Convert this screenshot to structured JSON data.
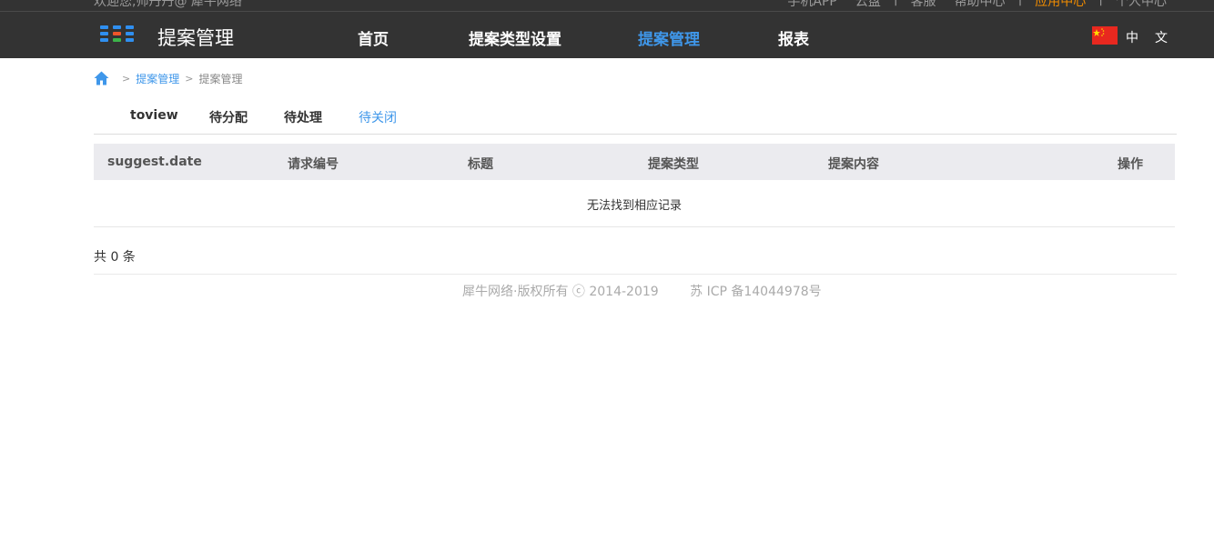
{
  "topbar": {
    "welcome": "欢迎您,帅丹丹@ 犀牛网络",
    "links": [
      "手机APP",
      "云盘",
      "客服",
      "帮助中心",
      "应用中心",
      "个人中心"
    ]
  },
  "header": {
    "app_title": "提案管理",
    "nav": [
      "首页",
      "提案类型设置",
      "提案管理",
      "报表"
    ],
    "lang": "中文"
  },
  "breadcrumb": {
    "link": "提案管理",
    "current": "提案管理"
  },
  "tabs": [
    "toview",
    "待分配",
    "待处理",
    "待关闭"
  ],
  "table": {
    "columns": [
      "suggest.date",
      "请求编号",
      "标题",
      "提案类型",
      "提案内容",
      "操作"
    ],
    "empty_text": "无法找到相应记录"
  },
  "total_text": "共 0 条",
  "footer": {
    "copyright": "犀牛网络·版权所有 ⓒ 2014-2019",
    "icp": "苏 ICP 备14044978号"
  },
  "colors": {
    "header_bg": "#333333",
    "accent": "#3f97ea",
    "highlight": "#f08c00",
    "table_header_bg": "#ebebef"
  }
}
